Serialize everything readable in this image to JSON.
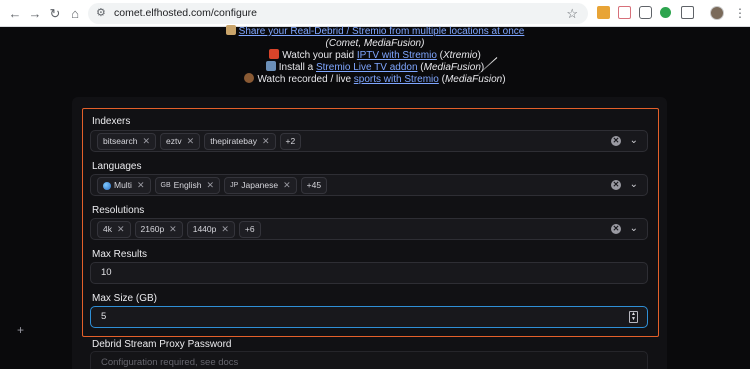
{
  "browser": {
    "url": "comet.elfhosted.com/configure",
    "icons": {
      "back": "arrow-left-icon",
      "forward": "arrow-right-icon",
      "reload": "reload-icon",
      "home": "home-icon",
      "site": "site-settings-icon",
      "bookmark": "star-icon",
      "menu": "kebab-menu-icon"
    }
  },
  "info_lines": [
    {
      "prefix": "",
      "link": "Share your Real-Debrid / Stremio from multiple locations at once",
      "middle": "",
      "tail": ""
    },
    {
      "prefix": "",
      "link": "",
      "middle": "",
      "tail": "(Comet, MediaFusion)"
    },
    {
      "prefix": "Watch your paid ",
      "link": "IPTV with Stremio",
      "middle": " (",
      "tail": "Xtremio"
    },
    {
      "prefix": "Install a ",
      "link": "Stremio Live TV addon",
      "middle": " (",
      "tail": "MediaFusion"
    },
    {
      "prefix": "Watch recorded / live ",
      "link": "sports with Stremio",
      "middle": " (",
      "tail": "MediaFusion"
    }
  ],
  "close_paren": ")",
  "form": {
    "indexers": {
      "label": "Indexers",
      "chips": [
        "bitsearch",
        "eztv",
        "thepiratebay"
      ],
      "more": "+2"
    },
    "languages": {
      "label": "Languages",
      "chips": [
        {
          "flag": "",
          "text": "Multi"
        },
        {
          "flag": "GB",
          "text": "English"
        },
        {
          "flag": "JP",
          "text": "Japanese"
        }
      ],
      "more": "+45"
    },
    "resolutions": {
      "label": "Resolutions",
      "chips": [
        "4k",
        "2160p",
        "1440p"
      ],
      "more": "+6"
    },
    "max_results": {
      "label": "Max Results",
      "value": "10"
    },
    "max_size": {
      "label": "Max Size (GB)",
      "value": "5"
    },
    "proxy_password": {
      "label": "Debrid Stream Proxy Password",
      "placeholder": "Configuration required, see docs"
    },
    "chip_remove": "✕",
    "clear_symbol": "✕",
    "chevron": "⌄"
  },
  "colors": {
    "accent_border": "#e4602a",
    "focus_border": "#2f8fd6",
    "link": "#7fa6ff",
    "background": "#0a0a0c"
  }
}
